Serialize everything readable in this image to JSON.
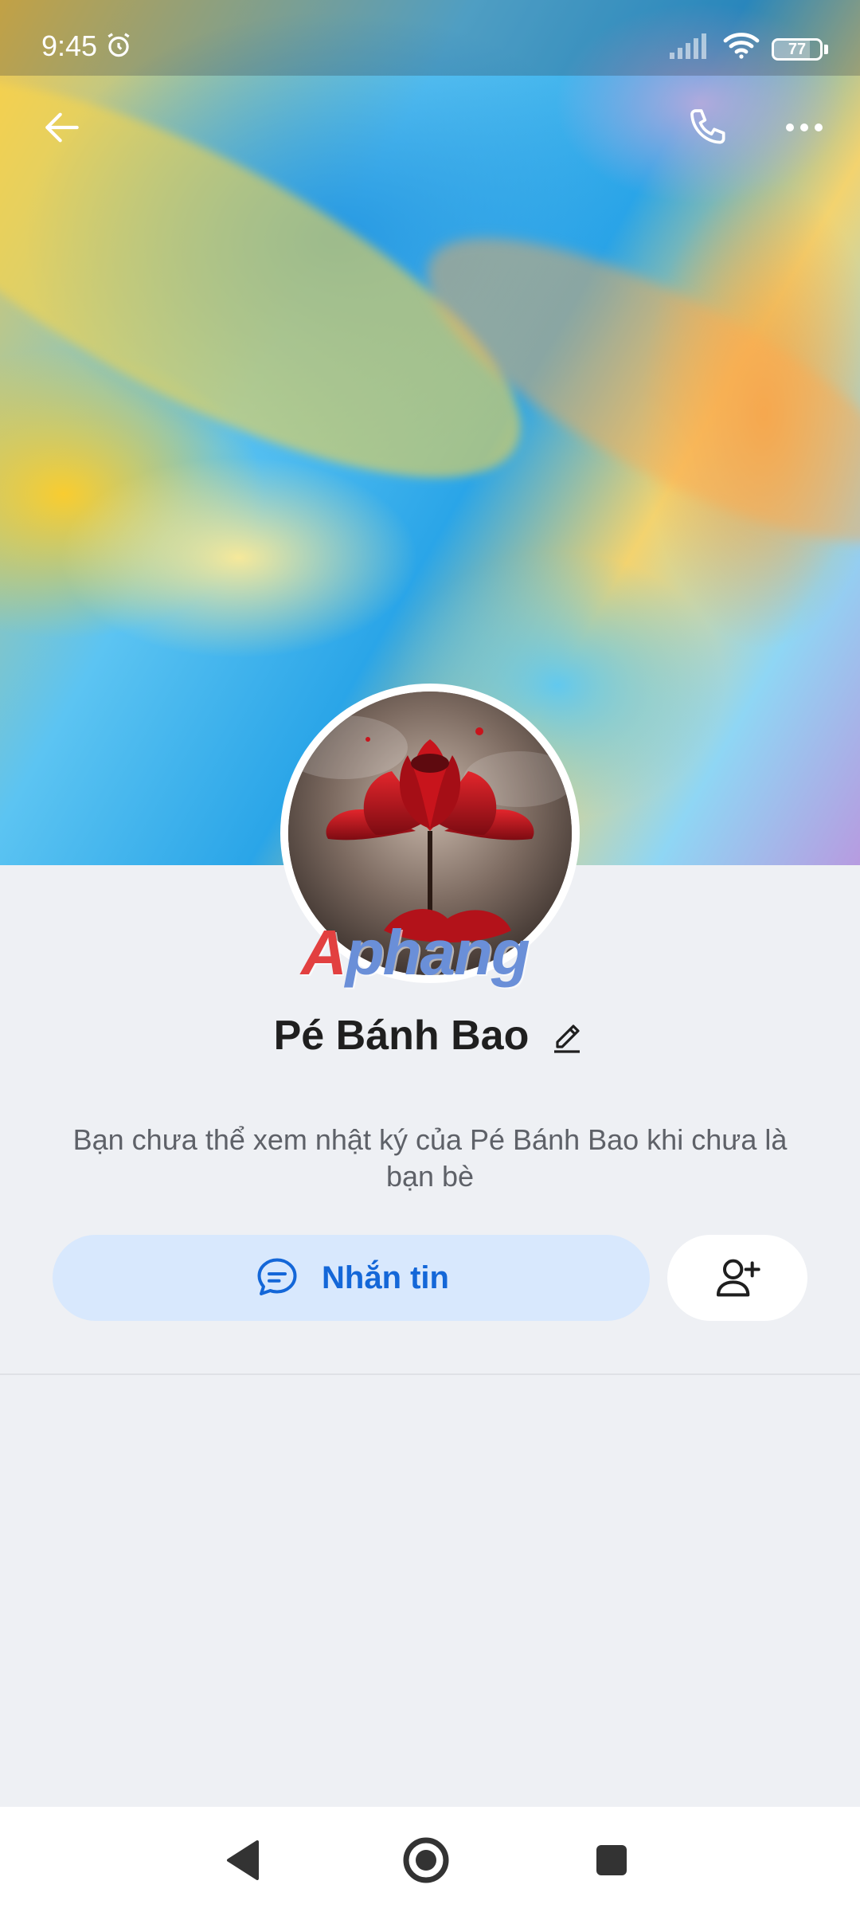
{
  "status_bar": {
    "time": "9:45",
    "alarm_icon": "alarm-clock-icon",
    "signal_icon": "cell-signal-icon",
    "wifi_icon": "wifi-icon",
    "battery_level": "77",
    "battery_fraction": 0.77
  },
  "header": {
    "back_icon": "arrow-left-icon",
    "call_icon": "phone-icon",
    "more_icon": "more-horizontal-icon"
  },
  "profile": {
    "name": "Pé Bánh Bao",
    "edit_icon": "pencil-icon",
    "avatar_icon": "red-lotus-avatar",
    "watermark_a": "A",
    "watermark_rest": "phang",
    "notice": "Bạn chưa thể xem nhật ký của Pé Bánh Bao khi chưa là bạn bè"
  },
  "actions": {
    "message_label": "Nhắn tin",
    "message_icon": "chat-bubble-icon",
    "add_friend_icon": "add-user-icon"
  },
  "nav": {
    "back_icon": "triangle-back-icon",
    "home_icon": "circle-home-icon",
    "recents_icon": "square-recents-icon"
  },
  "colors": {
    "accent": "#1467d8",
    "message_button_bg": "#d8e8fd",
    "page_bg": "#eef0f4"
  }
}
